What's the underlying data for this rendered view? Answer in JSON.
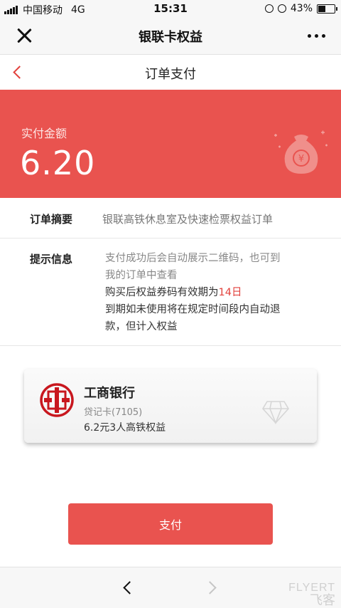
{
  "status_bar": {
    "carrier": "中国移动",
    "network": "4G",
    "time": "15:31",
    "battery": "43%",
    "battery_level": 0.43
  },
  "app_bar": {
    "title": "银联卡权益"
  },
  "page_nav": {
    "title": "订单支付"
  },
  "amount": {
    "label": "实付金额",
    "value": "6.20"
  },
  "order_summary": {
    "label": "订单摘要",
    "value": "银联高铁休息室及快速检票权益订单"
  },
  "tips": {
    "label": "提示信息",
    "line1": "支付成功后会自动展示二维码，也可到",
    "line2": "我的订单中查看",
    "line3_prefix": "购买后权益券码有效期为",
    "line3_highlight": "14日",
    "line4": "到期如未使用将在规定时间段内自动退",
    "line5": "款，但计入权益"
  },
  "card": {
    "bank_name": "工商银行",
    "card_type": "贷记卡(7105)",
    "benefit": "6.2元3人高铁权益"
  },
  "pay_button": {
    "label": "支付"
  },
  "watermark": {
    "line1": "FLYERT",
    "line2": "飞客"
  },
  "colors": {
    "accent": "#e9534f",
    "highlight": "#e2413c"
  },
  "icons": {
    "close": "close-icon",
    "more": "more-icon",
    "back": "back-icon",
    "money_bag": "money-bag-icon",
    "diamond": "diamond-icon",
    "bank_logo": "icbc-logo"
  }
}
